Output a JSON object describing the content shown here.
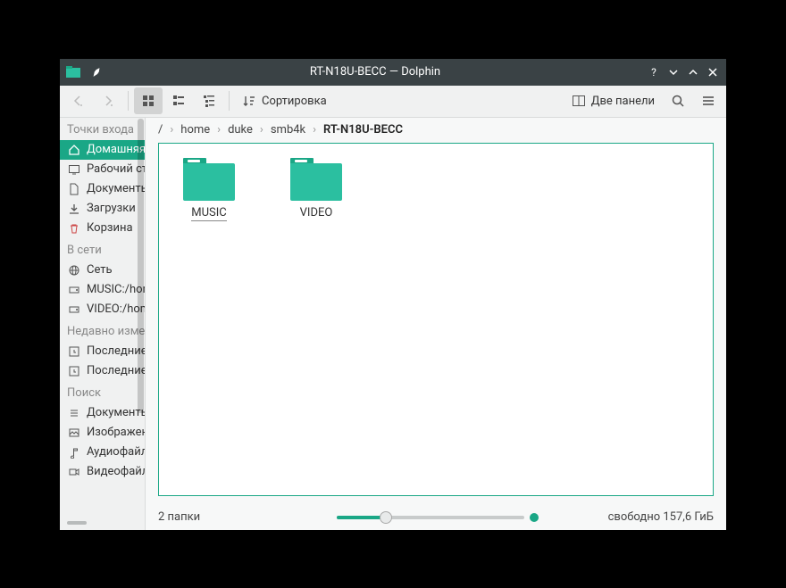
{
  "titlebar": {
    "title": "RT-N18U-BECC — Dolphin"
  },
  "toolbar": {
    "sort_label": "Сортировка",
    "panels_label": "Две панели"
  },
  "breadcrumb": {
    "root": "/",
    "parts": [
      "home",
      "duke",
      "smb4k"
    ],
    "current": "RT-N18U-BECC"
  },
  "sidebar": {
    "section_places": "Точки входа",
    "home": "Домашняя папка",
    "desktop": "Рабочий стол",
    "documents": "Документы",
    "downloads": "Загрузки",
    "trash": "Корзина",
    "section_network": "В сети",
    "network": "Сеть",
    "mount_music": "MUSIC:/home",
    "mount_video": "VIDEO:/home",
    "section_recent": "Недавно изменённые",
    "recent1": "Последние файлы",
    "recent2": "Последние места",
    "section_search": "Поиск",
    "s_documents": "Документы",
    "s_images": "Изображения",
    "s_audio": "Аудиофайлы",
    "s_video": "Видеофайлы"
  },
  "folders": [
    {
      "name": "MUSIC",
      "selected": true
    },
    {
      "name": "VIDEO",
      "selected": false
    }
  ],
  "status": {
    "count": "2 папки",
    "free": "свободно 157,6 ГиБ"
  }
}
